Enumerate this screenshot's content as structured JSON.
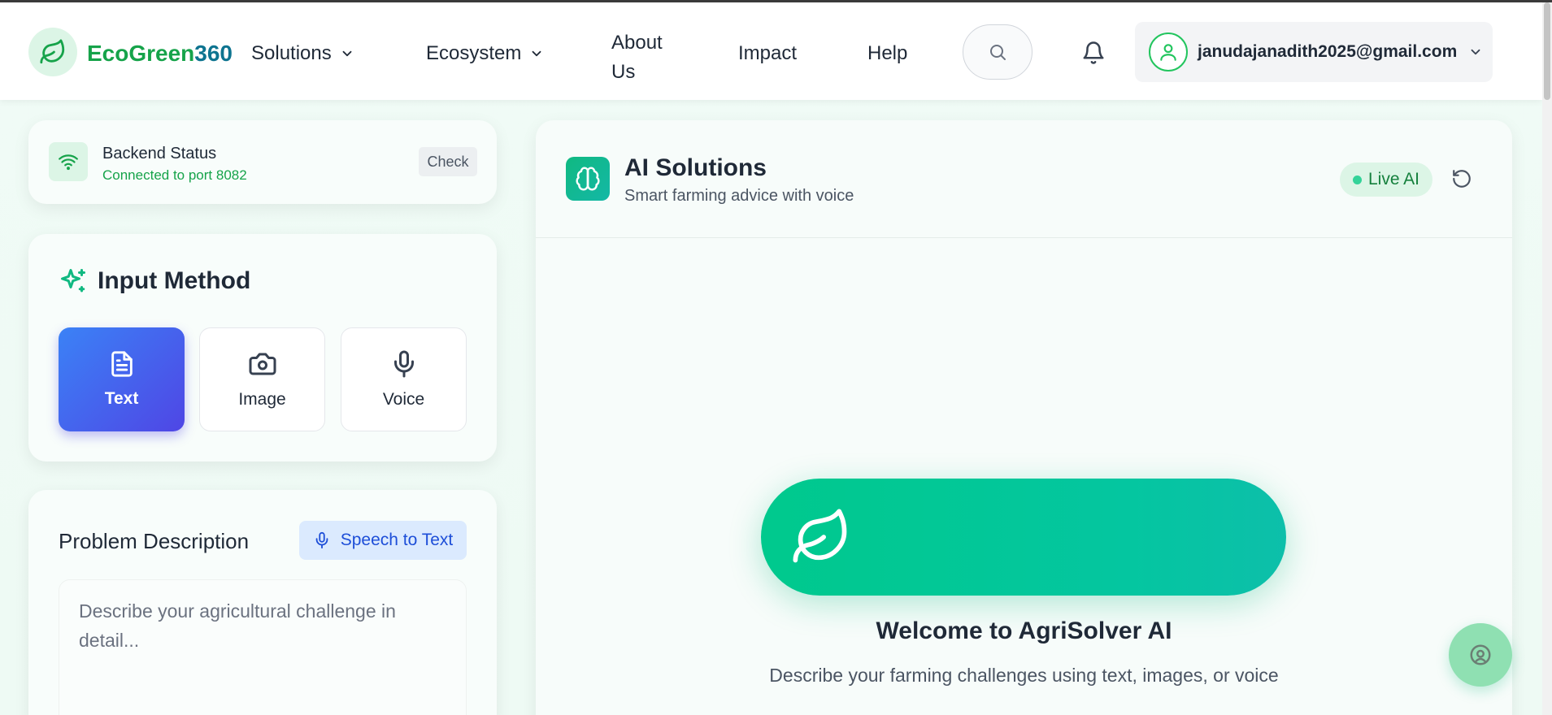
{
  "brand": {
    "eco": "EcoGreen",
    "num": "360"
  },
  "nav": {
    "solutions": "Solutions",
    "ecosystem": "Ecosystem",
    "about": "About Us",
    "impact": "Impact",
    "help": "Help"
  },
  "user": {
    "email": "janudajanadith2025@gmail.com"
  },
  "backend": {
    "title": "Backend Status",
    "status": "Connected to port 8082",
    "check_label": "Check"
  },
  "input_method": {
    "title": "Input Method",
    "options": [
      {
        "label": "Text",
        "icon": "document-icon",
        "active": true
      },
      {
        "label": "Image",
        "icon": "camera-icon",
        "active": false
      },
      {
        "label": "Voice",
        "icon": "microphone-icon",
        "active": false
      }
    ]
  },
  "problem": {
    "title": "Problem Description",
    "speech_label": "Speech to Text",
    "placeholder": "Describe your agricultural challenge in detail..."
  },
  "ai": {
    "title": "AI Solutions",
    "subtitle": "Smart farming advice with voice",
    "live_label": "Live AI",
    "welcome_title": "Welcome to AgriSolver AI",
    "welcome_sub": "Describe your farming challenges using text, images, or voice"
  },
  "colors": {
    "brand_green": "#16a34a",
    "brand_teal": "#0e7490",
    "accent_gradient_start": "#3b82f6",
    "accent_gradient_end": "#4f46e5",
    "hero_green": "#00c98d"
  }
}
